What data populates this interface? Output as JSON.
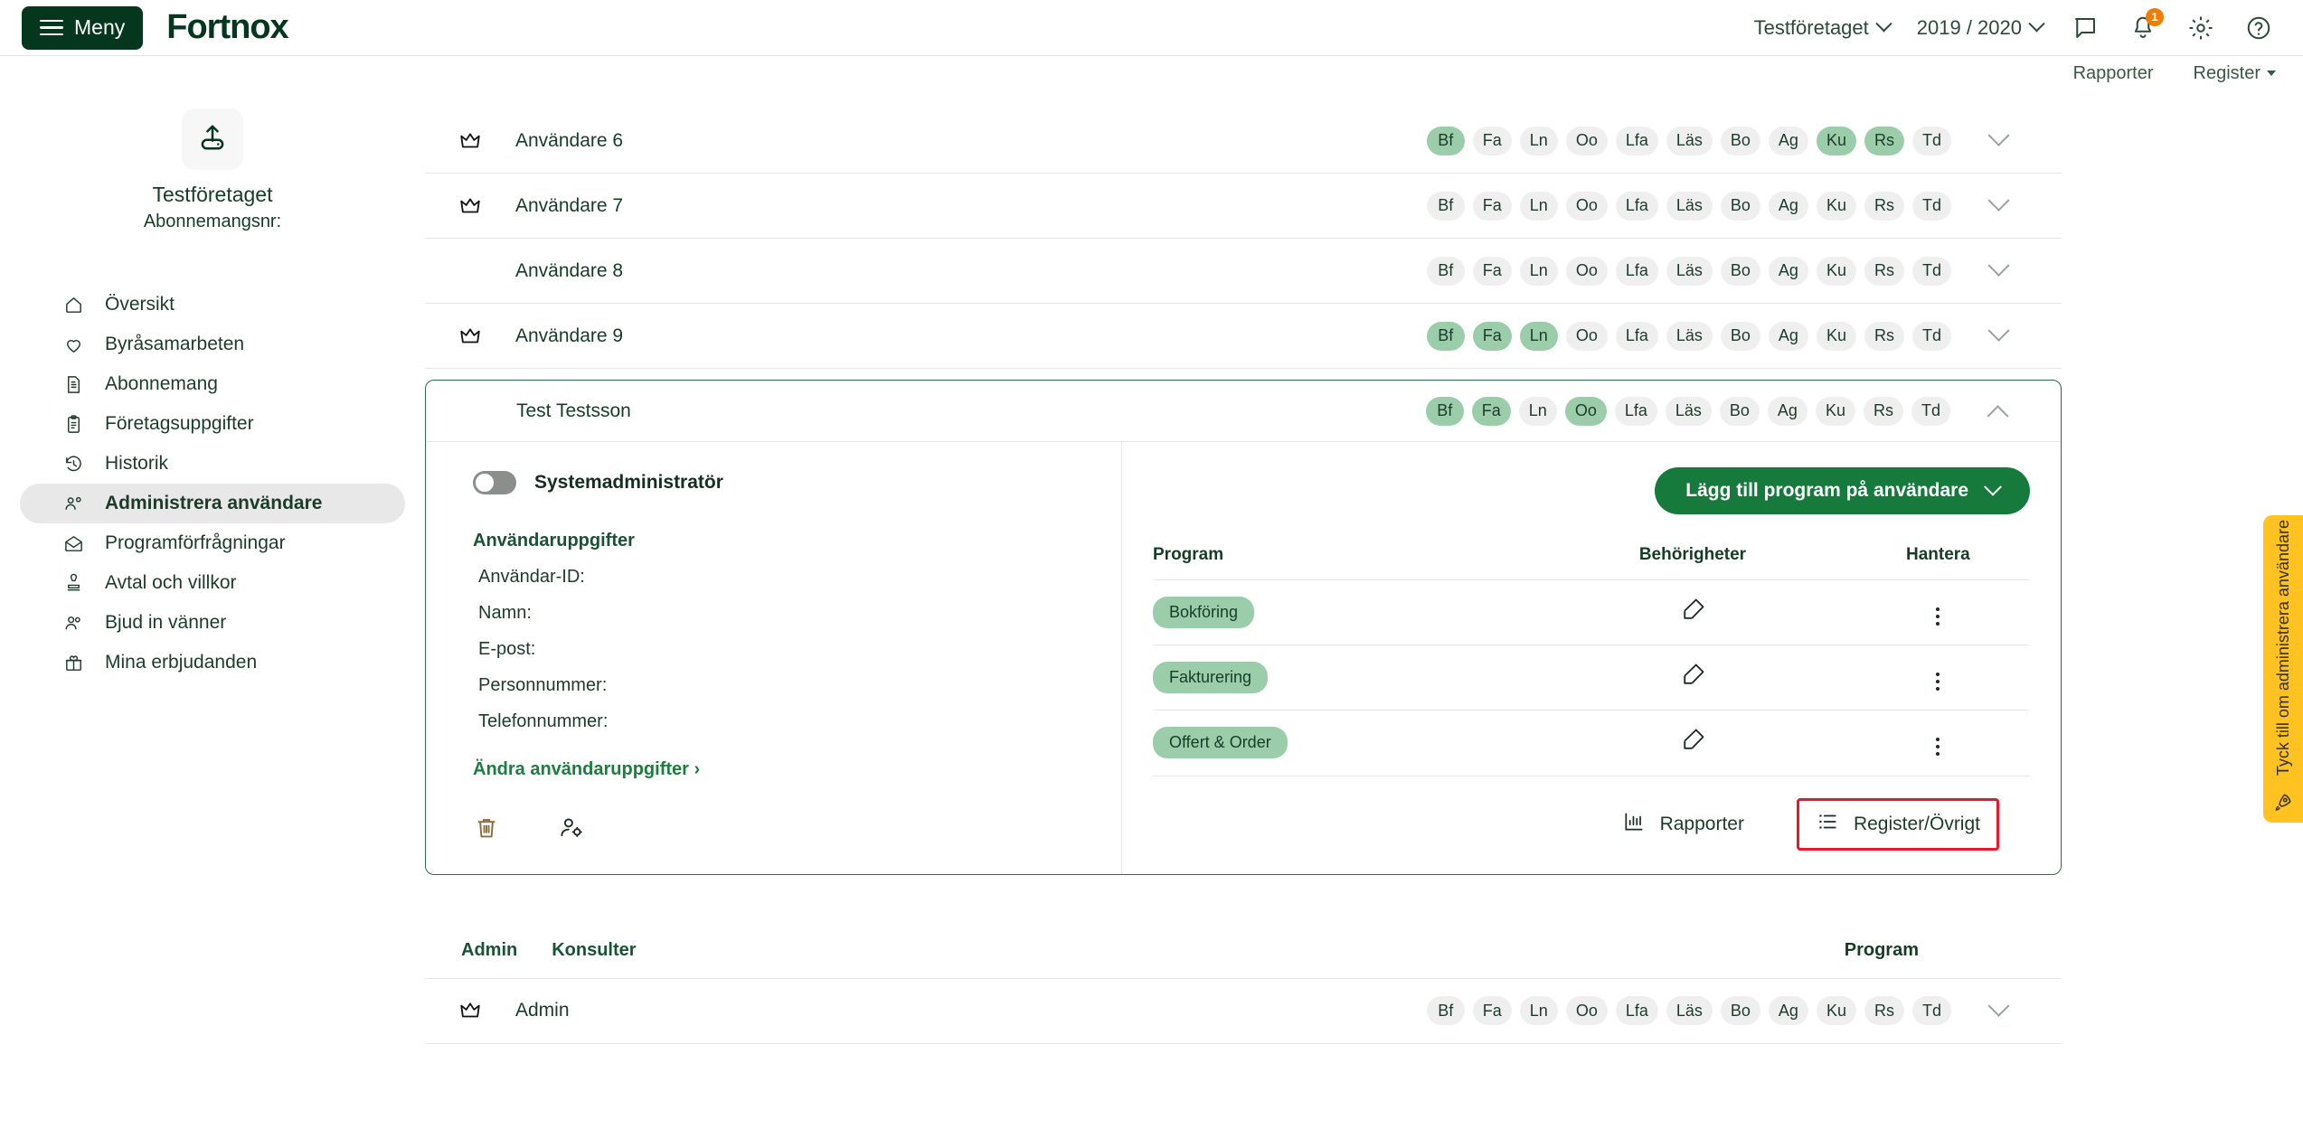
{
  "header": {
    "menu_label": "Meny",
    "brand": "Fortnox",
    "company_selector": "Testföretaget",
    "fiscal_year": "2019 / 2020",
    "notification_count": "1",
    "icons": [
      "chat-icon",
      "bell-icon",
      "gear-icon",
      "help-icon"
    ]
  },
  "subnav": {
    "items": [
      {
        "label": "Rapporter",
        "has_caret": false
      },
      {
        "label": "Register",
        "has_caret": true
      }
    ]
  },
  "sidebar": {
    "company_name": "Testföretaget",
    "subscription_label": "Abonnemangsnr:",
    "items": [
      {
        "label": "Översikt",
        "icon": "home-icon",
        "active": false
      },
      {
        "label": "Byråsamarbeten",
        "icon": "heart-icon",
        "active": false
      },
      {
        "label": "Abonnemang",
        "icon": "document-icon",
        "active": false
      },
      {
        "label": "Företagsuppgifter",
        "icon": "clipboard-icon",
        "active": false
      },
      {
        "label": "Historik",
        "icon": "history-icon",
        "active": false
      },
      {
        "label": "Administrera användare",
        "icon": "users-cog-icon",
        "active": true
      },
      {
        "label": "Programförfrågningar",
        "icon": "envelope-icon",
        "active": false
      },
      {
        "label": "Avtal och villkor",
        "icon": "stamp-icon",
        "active": false
      },
      {
        "label": "Bjud in vänner",
        "icon": "people-icon",
        "active": false
      },
      {
        "label": "Mina erbjudanden",
        "icon": "gift-icon",
        "active": false
      }
    ]
  },
  "main": {
    "badge_keys": [
      "Bf",
      "Fa",
      "Ln",
      "Oo",
      "Lfa",
      "Läs",
      "Bo",
      "Ag",
      "Ku",
      "Rs",
      "Td"
    ],
    "users": [
      {
        "name": "Användare 6",
        "admin": true,
        "active_badges": [
          "Bf",
          "Ku",
          "Rs"
        ]
      },
      {
        "name": "Användare 7",
        "admin": true,
        "active_badges": []
      },
      {
        "name": "Användare 8",
        "admin": false,
        "active_badges": []
      },
      {
        "name": "Användare 9",
        "admin": true,
        "active_badges": [
          "Bf",
          "Fa",
          "Ln"
        ]
      }
    ],
    "expanded_user": {
      "name": "Test Testsson",
      "admin": false,
      "active_badges": [
        "Bf",
        "Fa",
        "Oo"
      ],
      "sysadmin_toggle_label": "Systemadministratör",
      "sysadmin_toggle_on": false,
      "details_title": "Användaruppgifter",
      "fields": [
        {
          "label": "Användar-ID:",
          "value": ""
        },
        {
          "label": "Namn:",
          "value": ""
        },
        {
          "label": "E-post:",
          "value": ""
        },
        {
          "label": "Personnummer:",
          "value": ""
        },
        {
          "label": "Telefonnummer:",
          "value": ""
        }
      ],
      "edit_link": "Ändra användaruppgifter ›",
      "action_icons": [
        "trash-icon",
        "user-settings-icon"
      ],
      "add_program_button": "Lägg till program på användare",
      "program_table": {
        "columns": [
          "Program",
          "Behörigheter",
          "Hantera"
        ],
        "rows": [
          {
            "program": "Bokföring",
            "permission_icon": "edit-pencil-icon",
            "manage_icon": "kebab-menu-icon"
          },
          {
            "program": "Fakturering",
            "permission_icon": "edit-pencil-icon",
            "manage_icon": "kebab-menu-icon"
          },
          {
            "program": "Offert & Order",
            "permission_icon": "edit-pencil-icon",
            "manage_icon": "kebab-menu-icon"
          }
        ]
      },
      "footer_buttons": [
        {
          "label": "Rapporter",
          "icon": "bar-chart-icon",
          "highlighted": false
        },
        {
          "label": "Register/Övrigt",
          "icon": "list-icon",
          "highlighted": true
        }
      ]
    },
    "bottom_section": {
      "tabs": [
        "Admin",
        "Konsulter"
      ],
      "program_header": "Program",
      "rows": [
        {
          "name": "Admin",
          "admin": true,
          "active_badges": []
        }
      ]
    }
  },
  "feedback_tab": {
    "label": "Tyck till om administrera användare",
    "icon": "rocket-icon",
    "color": "#ffc220"
  },
  "colors": {
    "brand_dark": "#05371f",
    "brand_green": "#157a3c",
    "badge_active": "#9ccdab",
    "badge_inactive": "#efefef",
    "highlight_red": "#e8192c",
    "notification_orange": "#f07d00"
  }
}
